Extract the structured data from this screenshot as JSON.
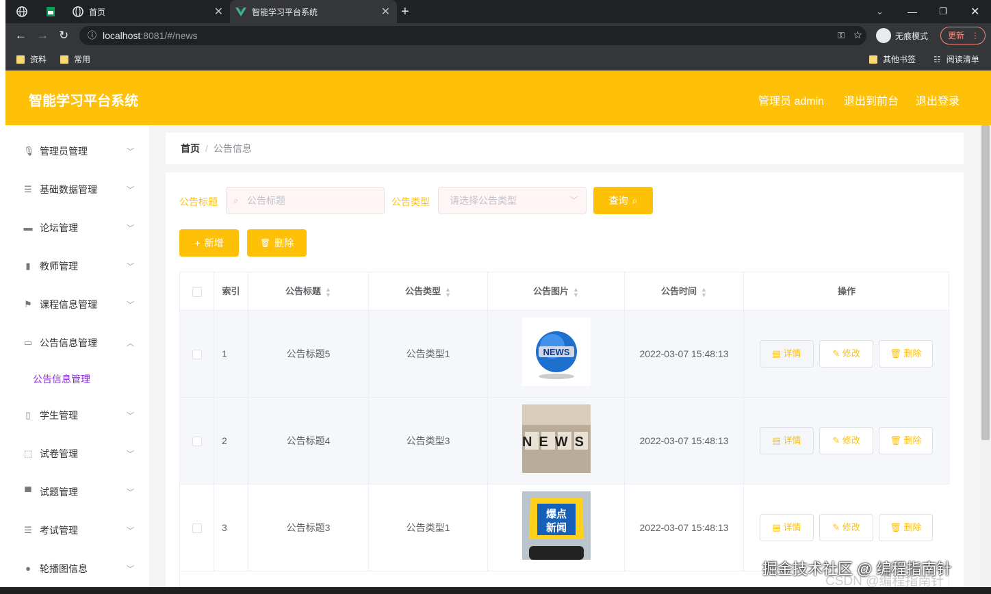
{
  "browser": {
    "tabs": [
      {
        "label": "首页"
      },
      {
        "label": "智能学习平台系统"
      }
    ],
    "url_host": "localhost",
    "url_rest": ":8081/#/news",
    "incognito": "无痕模式",
    "update": "更新",
    "bookmarks": [
      "资料",
      "常用"
    ],
    "bookmarks_right": [
      "其他书签",
      "阅读清单"
    ]
  },
  "header": {
    "brand": "智能学习平台系统",
    "admin": "管理员 admin",
    "front": "退出到前台",
    "logout": "退出登录"
  },
  "sidebar": {
    "items": [
      {
        "label": "管理员管理",
        "icon": "microphone-icon"
      },
      {
        "label": "基础数据管理",
        "icon": "list-icon"
      },
      {
        "label": "论坛管理",
        "icon": "monitor-icon"
      },
      {
        "label": "教师管理",
        "icon": "bar-chart-icon"
      },
      {
        "label": "课程信息管理",
        "icon": "flag-icon"
      },
      {
        "label": "公告信息管理",
        "icon": "chat-icon"
      },
      {
        "label": "学生管理",
        "icon": "mic-stand-icon"
      },
      {
        "label": "试卷管理",
        "icon": "line-chart-icon"
      },
      {
        "label": "试题管理",
        "icon": "printer-icon"
      },
      {
        "label": "考试管理",
        "icon": "sliders-icon"
      },
      {
        "label": "轮播图信息",
        "icon": "user-icon"
      }
    ],
    "sub_active": "公告信息管理"
  },
  "breadcrumb": {
    "home": "首页",
    "sep": "/",
    "current": "公告信息"
  },
  "search": {
    "title_label": "公告标题",
    "title_placeholder": "公告标题",
    "type_label": "公告类型",
    "type_placeholder": "请选择公告类型",
    "query": "查询"
  },
  "actions": {
    "add": "新增",
    "delete": "删除"
  },
  "table": {
    "headers": [
      "索引",
      "公告标题",
      "公告类型",
      "公告图片",
      "公告时间",
      "操作"
    ],
    "rows": [
      {
        "index": "1",
        "title": "公告标题5",
        "type": "公告类型1",
        "time": "2022-03-07 15:48:13"
      },
      {
        "index": "2",
        "title": "公告标题4",
        "type": "公告类型3",
        "time": "2022-03-07 15:48:13"
      },
      {
        "index": "3",
        "title": "公告标题3",
        "type": "公告类型1",
        "time": "2022-03-07 15:48:13"
      }
    ],
    "op_detail": "详情",
    "op_edit": "修改",
    "op_delete": "删除",
    "img_news": "NEWS",
    "img_hot": "爆点新闻"
  },
  "watermark": {
    "main": "掘金技术社区 @ 编程指南针",
    "sub": "CSDN @编程指南针"
  },
  "colors": {
    "accent": "#ffc107",
    "sidebar_active": "#8a2be2"
  }
}
